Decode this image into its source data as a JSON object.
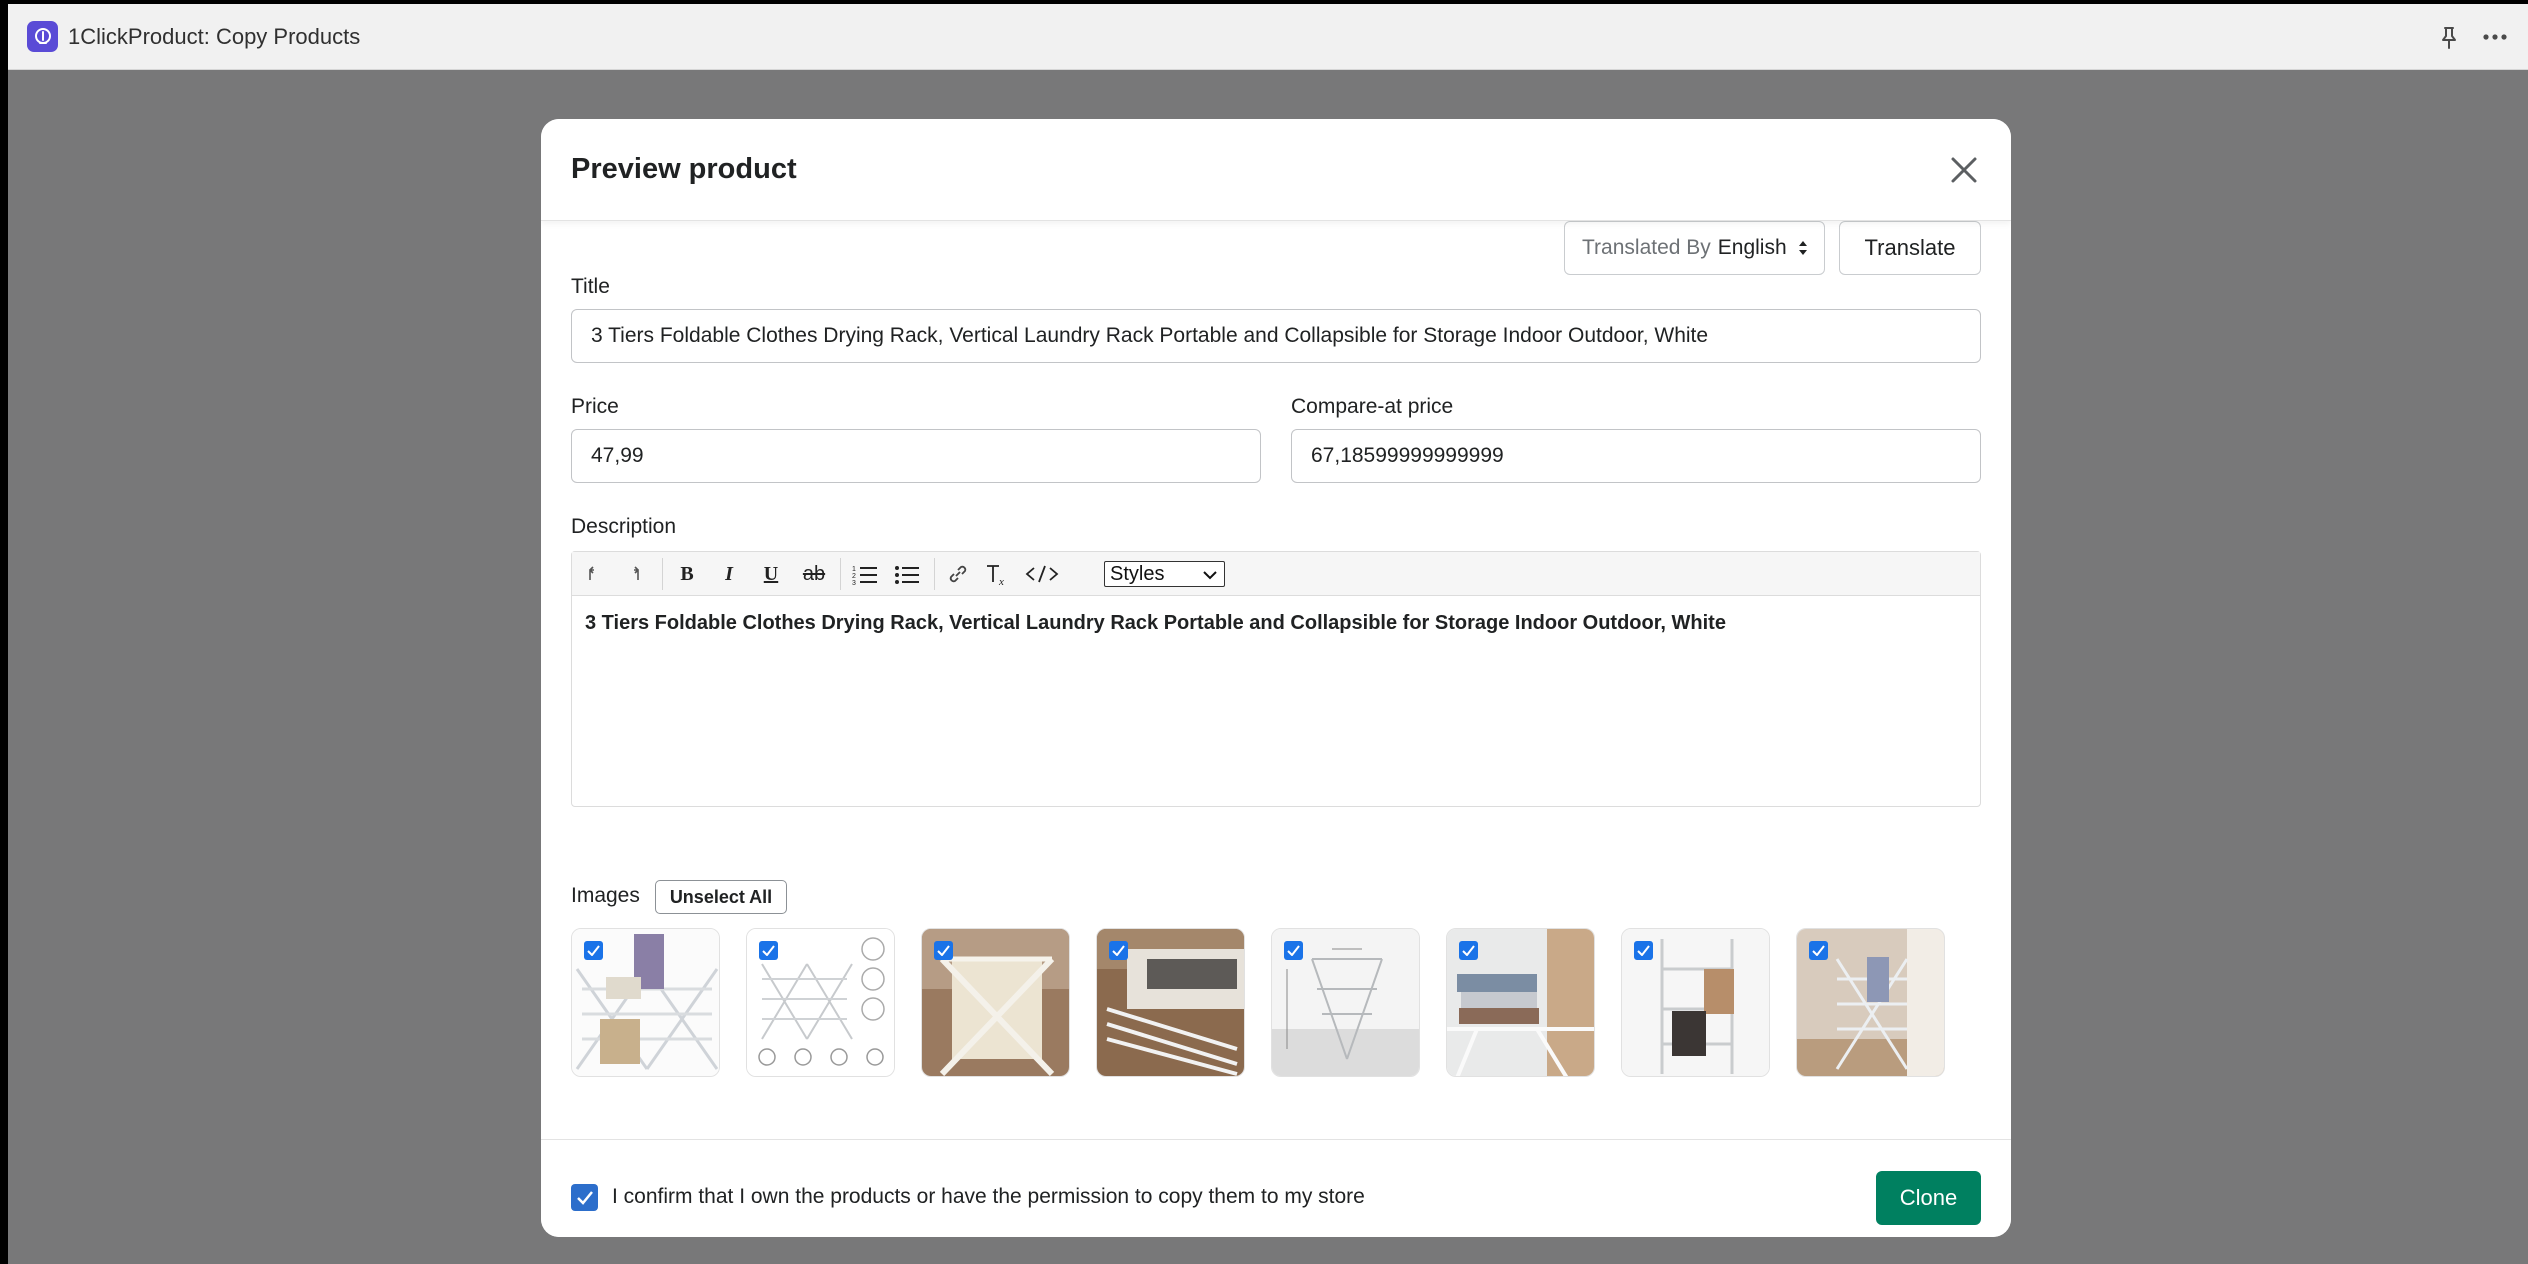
{
  "app": {
    "title": "1ClickProduct: Copy Products"
  },
  "modal": {
    "title": "Preview product",
    "translate": {
      "prefix": "Translated By",
      "language": "English",
      "button": "Translate"
    },
    "fields": {
      "title_label": "Title",
      "title_value": "3 Tiers Foldable Clothes Drying Rack, Vertical Laundry Rack Portable and Collapsible for Storage Indoor Outdoor, White",
      "price_label": "Price",
      "price_value": "47,99",
      "compare_label": "Compare-at price",
      "compare_value": "67,18599999999999",
      "description_label": "Description",
      "description_text": "3 Tiers Foldable Clothes Drying Rack, Vertical Laundry Rack Portable and Collapsible for Storage Indoor Outdoor, White"
    },
    "toolbar": {
      "bold": "B",
      "italic": "I",
      "underline": "U",
      "strike": "ab",
      "styles": "Styles"
    },
    "images": {
      "label": "Images",
      "unselect_all": "Unselect All",
      "items": [
        {
          "name": "rack-with-towels",
          "selected": true
        },
        {
          "name": "rack-diagram",
          "selected": true
        },
        {
          "name": "rack-cream-fabric",
          "selected": true
        },
        {
          "name": "rack-by-bed",
          "selected": true
        },
        {
          "name": "rack-dimensions",
          "selected": true
        },
        {
          "name": "rack-folded-towels",
          "selected": true
        },
        {
          "name": "rack-hanging-clothes",
          "selected": true
        },
        {
          "name": "rack-by-window",
          "selected": true
        }
      ]
    },
    "footer": {
      "confirm_text": "I confirm that I own the products or have the permission to copy them to my store",
      "confirm_checked": true,
      "clone_button": "Clone"
    }
  },
  "colors": {
    "primary": "#008060",
    "checkbox": "#2c6ecb",
    "backdrop": "#787879",
    "app_icon": "#5a4bd6"
  }
}
